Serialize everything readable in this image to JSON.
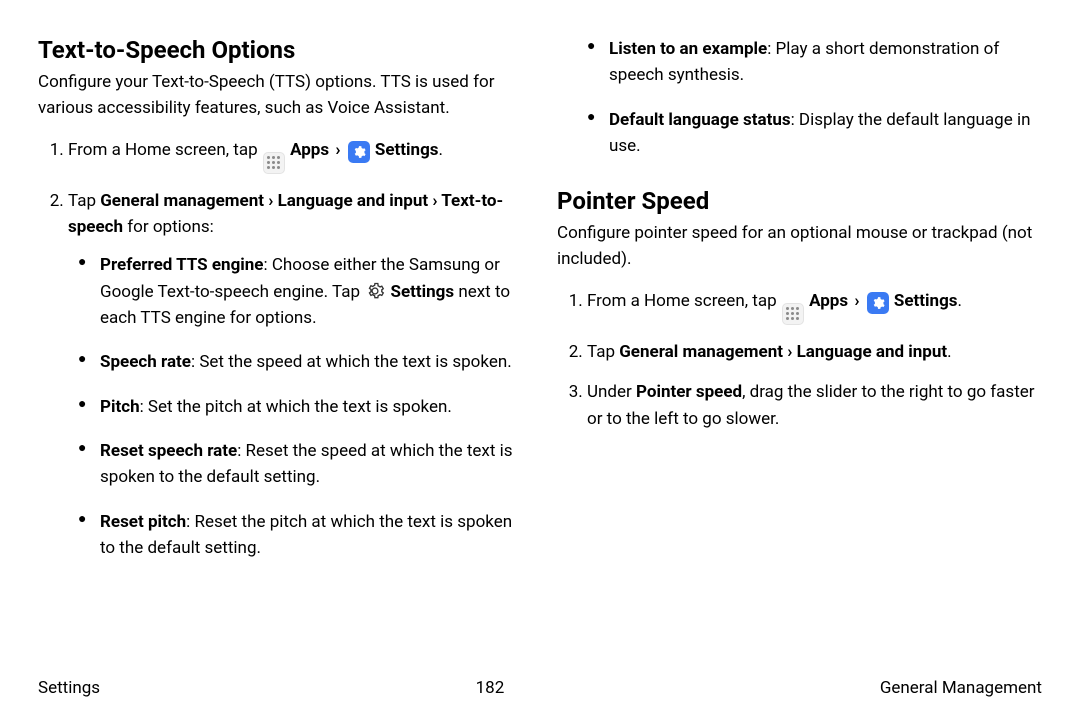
{
  "left": {
    "heading": "Text-to-Speech Options",
    "intro": "Configure your Text-to-Speech (TTS) options. TTS is used for various accessibility features, such as Voice Assistant.",
    "step1_pre": "From a Home screen, tap ",
    "apps": "Apps",
    "sep": "›",
    "settings": "Settings",
    "step1_post": ".",
    "step2_pre": "Tap ",
    "step2_path": "General management › Language and input › Text-to-speech",
    "step2_post": " for options:",
    "bullets": {
      "b1_label": "Preferred TTS engine",
      "b1_textA": ": Choose either the Samsung or Google Text-to-speech engine. Tap ",
      "b1_settings": "Settings",
      "b1_textB": " next to each TTS engine for options.",
      "b2_label": "Speech rate",
      "b2_text": ": Set the speed at which the text is spoken.",
      "b3_label": "Pitch",
      "b3_text": ": Set the pitch at which the text is spoken.",
      "b4_label": "Reset speech rate",
      "b4_text": ": Reset the speed at which the text is spoken to the default setting.",
      "b5_label": "Reset pitch",
      "b5_text": ": Reset the pitch at which the text is spoken to the default setting."
    }
  },
  "right": {
    "bullets_top": {
      "b6_label": "Listen to an example",
      "b6_text": ": Play a short demonstration of speech synthesis.",
      "b7_label": "Default language status",
      "b7_text": ": Display the default language in use."
    },
    "heading": "Pointer Speed",
    "intro": "Configure pointer speed for an optional mouse or trackpad (not included).",
    "step1_pre": "From a Home screen, tap ",
    "apps": "Apps",
    "sep": "›",
    "settings": "Settings",
    "step1_post": ".",
    "step2_pre": "Tap ",
    "step2_path": "General management › Language and input",
    "step2_post": ".",
    "step3_pre": "Under ",
    "step3_bold": "Pointer speed",
    "step3_post": ", drag the slider to the right to go faster or to the left to go slower."
  },
  "footer": {
    "left": "Settings",
    "center": "182",
    "right": "General Management"
  }
}
